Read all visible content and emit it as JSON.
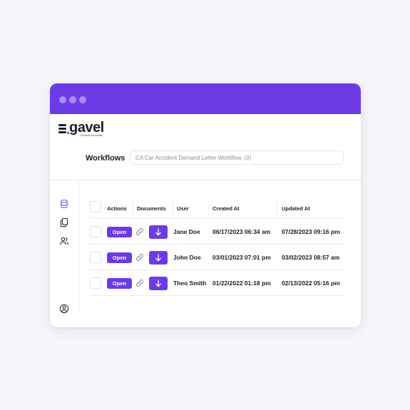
{
  "app": {
    "logo_text": "gavel",
    "logo_tagline": "Formerly Documate",
    "brand_color": "#6c3be6"
  },
  "workflows": {
    "label": "Workflows",
    "selected": "CA Car Accident Demand Letter Workflow",
    "count": "(3)"
  },
  "sidebar": {
    "icons": [
      "database-icon",
      "documents-icon",
      "users-icon",
      "account-icon"
    ]
  },
  "table": {
    "columns": [
      "Actions",
      "Documents",
      "User",
      "Created At",
      "Updated At"
    ],
    "open_label": "Open",
    "rows": [
      {
        "user": "Jane Doe",
        "created": "06/17/2023 06:34 am",
        "updated": "07/28/2023 09:16 pm"
      },
      {
        "user": "John Doe",
        "created": "03/01/2023 07:01 pm",
        "updated": "03/02/2023 08:57 am"
      },
      {
        "user": "Theo Smith",
        "created": "01/22/2022 01:18 pm",
        "updated": "02/13/2022 05:16 pm"
      }
    ]
  }
}
